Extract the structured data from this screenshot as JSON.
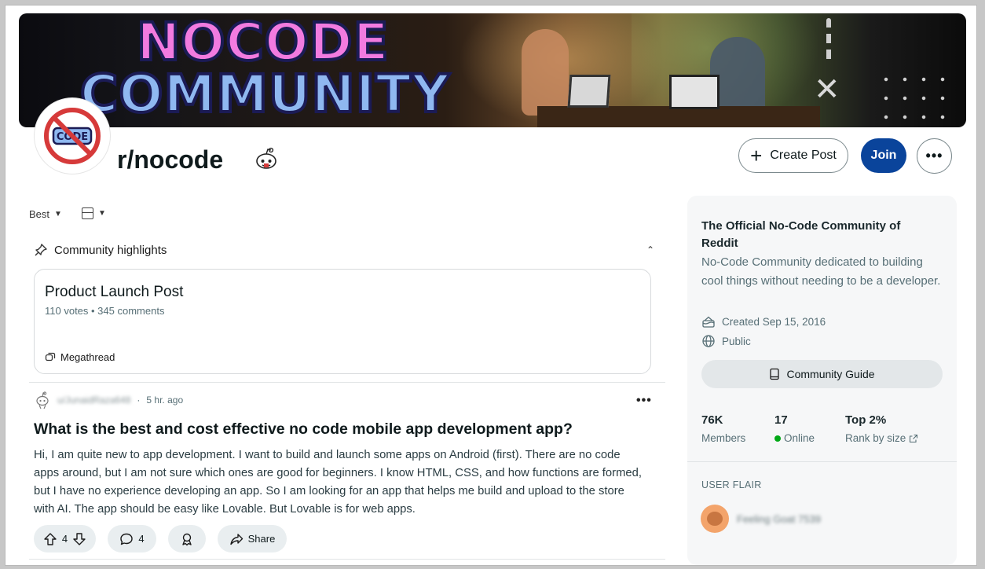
{
  "banner": {
    "title_line1": "NOCODE",
    "title_line2": "COMMUNITY",
    "close_glyph": "✕"
  },
  "header": {
    "subreddit_name": "r/nocode",
    "create_post_label": "Create Post",
    "join_label": "Join",
    "more_label": "•••"
  },
  "feed": {
    "sort_label": "Best",
    "highlights": {
      "label": "Community highlights",
      "card": {
        "title": "Product Launch Post",
        "meta": "110 votes • 345 comments",
        "tag": "Megathread"
      }
    },
    "post": {
      "username": "u/JunaidRaza648",
      "time": "5 hr. ago",
      "title": "What is the best and cost effective no code mobile app development app?",
      "body": "Hi, I am quite new to app development. I want to build and launch some apps on Android (first). There are no code apps around, but I am not sure which ones are good for beginners. I know HTML, CSS, and how functions are formed, but I have no experience developing an app. So I am looking for an app that helps me build and upload to the store with AI. The app should be easy like Lovable. But Lovable is for web apps.",
      "votes": "4",
      "comments": "4",
      "share_label": "Share",
      "more_label": "•••"
    }
  },
  "sidebar": {
    "title": "The Official No-Code Community of Reddit",
    "description": "No-Code Community dedicated to building cool things without needing to be a developer.",
    "created": "Created Sep 15, 2016",
    "visibility": "Public",
    "guide_label": "Community Guide",
    "stats": [
      {
        "value": "76K",
        "label": "Members"
      },
      {
        "value": "17",
        "label": "Online"
      },
      {
        "value": "Top 2%",
        "label": "Rank by size"
      }
    ],
    "flair_heading": "USER FLAIR",
    "flair_name": "Feeling Goat 7539"
  },
  "colors": {
    "join_button": "#0a449b",
    "online_dot": "#01a816",
    "accent_pink": "#f27be0",
    "accent_blue": "#8fb8f0"
  }
}
